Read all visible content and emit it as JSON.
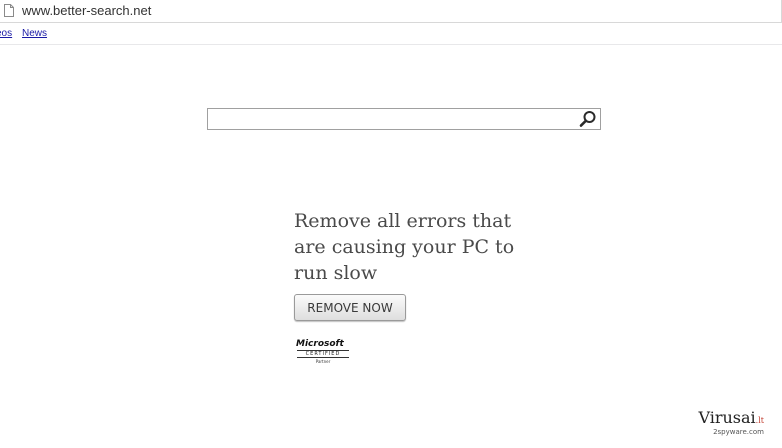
{
  "browser": {
    "url": "www.better-search.net"
  },
  "nav": {
    "links": [
      "eos",
      "News"
    ]
  },
  "search": {
    "value": "",
    "placeholder": ""
  },
  "ad": {
    "headline": "Remove all errors that are causing your PC to run slow",
    "button_label": "REMOVE NOW",
    "badge_brand": "Microsoft",
    "badge_cert": "CERTIFIED",
    "badge_partner": "Partner"
  },
  "watermark": {
    "brand": "Virusai",
    "tld": ".lt",
    "sub": "2spyware.com"
  },
  "icons": {
    "page": "page-icon",
    "search": "search-icon"
  },
  "colors": {
    "link": "#1a1aa6",
    "headline": "#4a4a4a",
    "watermark_accent": "#c0392b"
  }
}
